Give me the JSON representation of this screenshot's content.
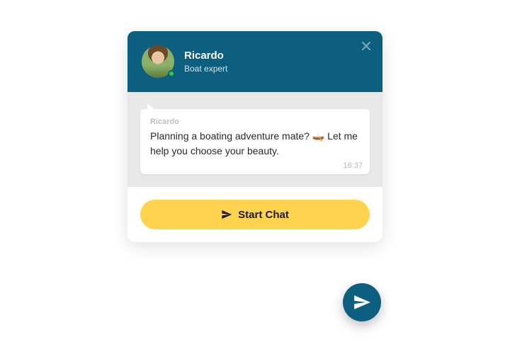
{
  "agent": {
    "name": "Ricardo",
    "role": "Boat expert",
    "online": true
  },
  "message": {
    "sender": "Ricardo",
    "text": "Planning a boating adventure mate? 🛶 Let me help you choose your beauty.",
    "time": "16:37"
  },
  "cta": {
    "label": "Start Chat"
  },
  "icons": {
    "close": "close-icon",
    "send": "paper-plane-icon",
    "fab": "paper-plane-icon"
  },
  "colors": {
    "header": "#0d5f80",
    "accent": "#ffd34d",
    "presence": "#2ecc40"
  }
}
